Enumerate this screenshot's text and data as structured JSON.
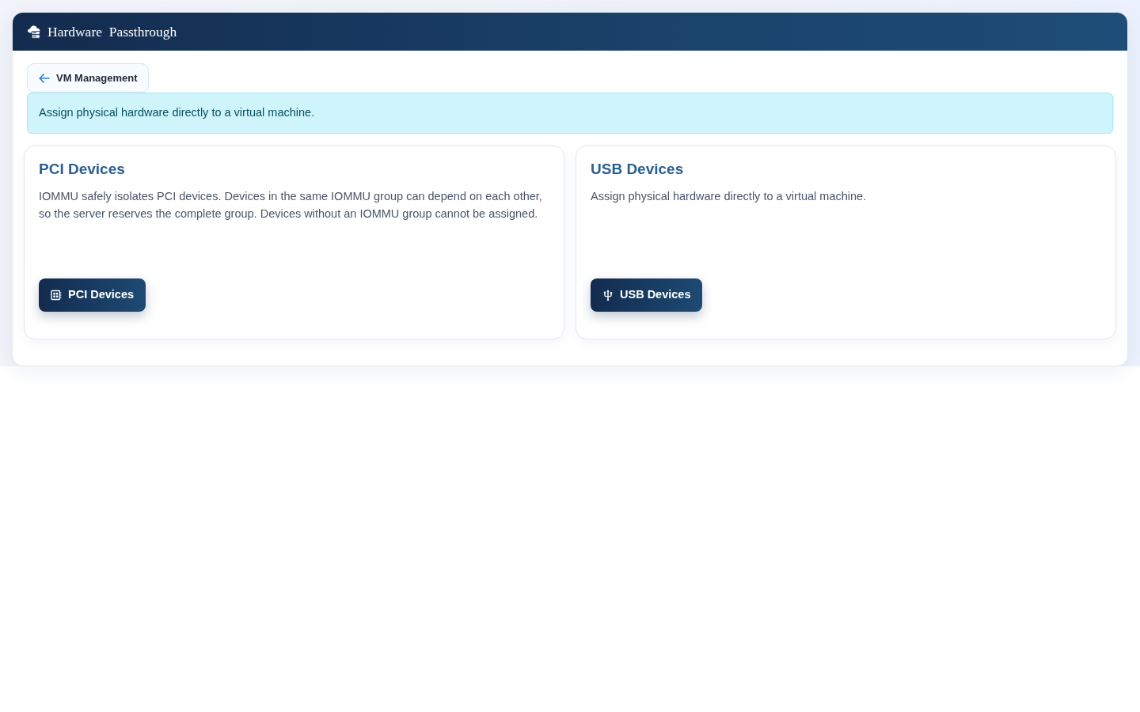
{
  "header": {
    "title": "Hardware  Passthrough"
  },
  "back_link": {
    "label": "VM Management"
  },
  "alert": {
    "text": "Assign physical hardware directly to a virtual machine."
  },
  "cards": [
    {
      "kind": "pci",
      "title": "PCI Devices",
      "description": "IOMMU safely isolates PCI devices. Devices in the same IOMMU group can depend on each other, so the server reserves the complete group. Devices without an IOMMU group cannot be assigned.",
      "button": {
        "label": "PCI Devices"
      }
    },
    {
      "kind": "usb",
      "title": "USB Devices",
      "description": "Assign physical hardware directly to a virtual machine.",
      "button": {
        "label": "USB Devices"
      }
    }
  ]
}
